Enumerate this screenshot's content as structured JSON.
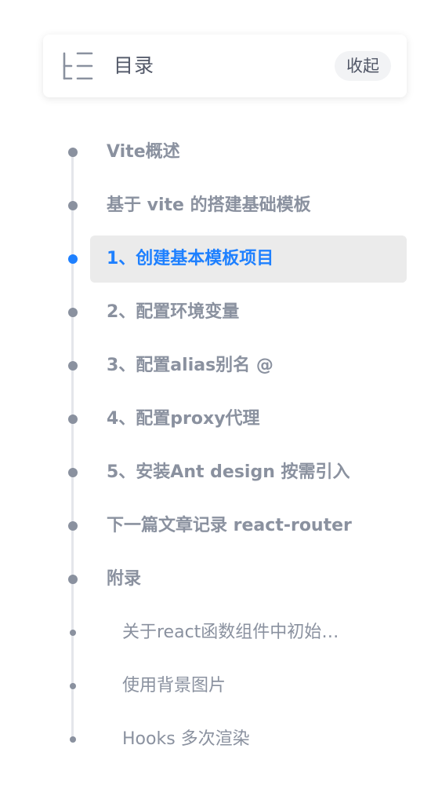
{
  "toc": {
    "icon": "outline-list-icon",
    "title": "目录",
    "collapse_label": "收起",
    "items": [
      {
        "label": "Vite概述",
        "level": 1,
        "active": false
      },
      {
        "label": "基于 vite 的搭建基础模板",
        "level": 1,
        "active": false
      },
      {
        "label": "1、创建基本模板项目",
        "level": 1,
        "active": true
      },
      {
        "label": "2、配置环境变量",
        "level": 1,
        "active": false
      },
      {
        "label": "3、配置alias别名 @",
        "level": 1,
        "active": false
      },
      {
        "label": "4、配置proxy代理",
        "level": 1,
        "active": false
      },
      {
        "label": "5、安装Ant design 按需引入",
        "level": 1,
        "active": false
      },
      {
        "label": "下一篇文章记录 react-router",
        "level": 1,
        "active": false
      },
      {
        "label": "附录",
        "level": 1,
        "active": false
      },
      {
        "label": "关于react函数组件中初始化数据",
        "level": 2,
        "active": false
      },
      {
        "label": "使用背景图片",
        "level": 2,
        "active": false
      },
      {
        "label": "Hooks 多次渲染",
        "level": 2,
        "active": false
      }
    ]
  },
  "colors": {
    "text": "#8a919f",
    "title": "#515767",
    "active": "#1e80ff",
    "active_bg": "#ebebeb",
    "line": "#e4e6eb"
  }
}
